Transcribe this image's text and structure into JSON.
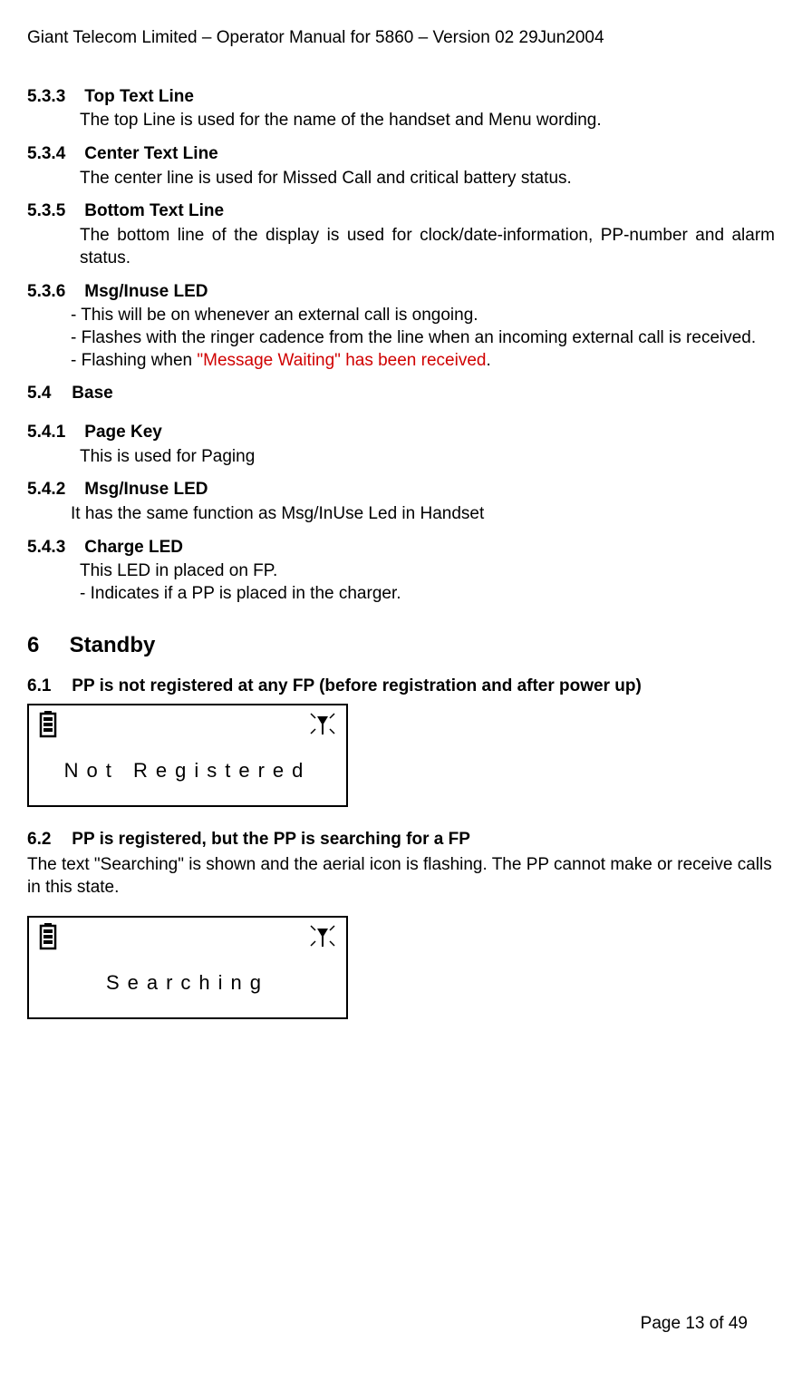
{
  "header": "Giant Telecom Limited – Operator Manual for 5860 – Version 02 29Jun2004",
  "sections": {
    "s533_num": "5.3.3",
    "s533_title": "Top Text Line",
    "s533_body": "The top Line is used for the name of the handset and Menu wording.",
    "s534_num": "5.3.4",
    "s534_title": "Center Text Line",
    "s534_body": "The center line is used for Missed Call and critical battery status.",
    "s535_num": "5.3.5",
    "s535_title": "Bottom Text Line",
    "s535_body": "The bottom line of the display is used for clock/date-information, PP-number and alarm status.",
    "s536_num": "5.3.6",
    "s536_title": "Msg/Inuse LED",
    "s536_line1": "- This will be on whenever an external call is ongoing.",
    "s536_line2": "- Flashes with the ringer cadence from the line when an incoming external call is received.",
    "s536_line3a": "- Flashing when ",
    "s536_line3b": "\"Message Waiting\" has been received",
    "s536_line3c": ".",
    "s54_num": "5.4",
    "s54_title": "Base",
    "s541_num": "5.4.1",
    "s541_title": "Page Key",
    "s541_body": "This is used for Paging",
    "s542_num": "5.4.2",
    "s542_title": "Msg/Inuse LED",
    "s542_body": "It has the same function as Msg/InUse Led in Handset",
    "s543_num": "5.4.3",
    "s543_title": "Charge LED",
    "s543_line1": "This LED in placed on FP.",
    "s543_line2": "- Indicates if a PP is placed in the charger.",
    "s6_num": "6",
    "s6_title": "Standby",
    "s61_num": "6.1",
    "s61_title": "PP is not registered at any FP (before registration and after power up)",
    "s62_num": "6.2",
    "s62_title": "PP is registered, but the PP is searching for a FP",
    "s62_body": "The text \"Searching\" is shown and the aerial icon is flashing. The PP cannot make or receive calls in this state."
  },
  "displays": {
    "d1_text": "Not Registered",
    "d2_text": "Searching"
  },
  "footer": "Page 13 of 49"
}
